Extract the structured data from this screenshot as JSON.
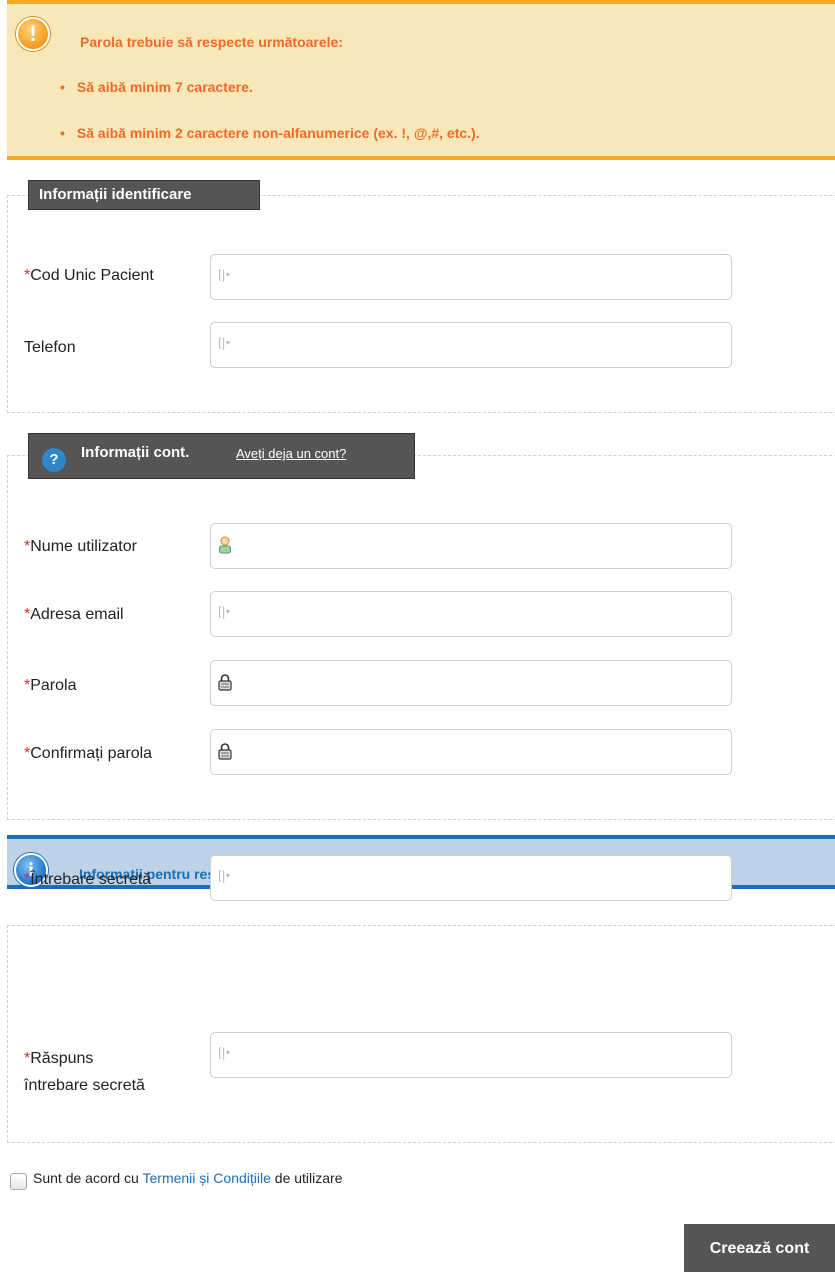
{
  "warning": {
    "title": "Parola trebuie să respecte următoarele:",
    "items": [
      "Să aibă minim 7 caractere.",
      "Să aibă minim 2 caractere non-alfanumerice (ex. !, @,#, etc.)."
    ],
    "icon": "warning-icon",
    "color": "#f26a2a"
  },
  "identification": {
    "legend": "Informații identificare",
    "fields": [
      {
        "label": "Cod Unic Pacient",
        "required": "*",
        "value": ""
      },
      {
        "label": "Telefon",
        "required": "",
        "value": ""
      }
    ]
  },
  "account": {
    "legend": "Informații cont.",
    "link": "Aveți deja un cont?",
    "fields": [
      {
        "label": "Nume utilizator",
        "required": "*",
        "value": "",
        "icon": "user-icon"
      },
      {
        "label": "Adresa email",
        "required": "*",
        "value": "",
        "icon": "text-cursor-icon"
      },
      {
        "label": "Parola",
        "required": "*",
        "value": "",
        "icon": "lock-icon"
      },
      {
        "label": "Confirmați parola",
        "required": "*",
        "value": "",
        "icon": "lock-icon"
      }
    ]
  },
  "reset": {
    "info": "Informatii pentru resetare parola.",
    "fields": [
      {
        "label": "Întrebare secretă",
        "required": "*",
        "value": ""
      },
      {
        "label_line1": "Răspuns",
        "label_line2": "întrebare secretă",
        "required": "*",
        "value": ""
      }
    ]
  },
  "terms": {
    "prefix": "Sunt de acord cu",
    "link": "Termenii și Condițiile",
    "suffix": "de utilizare"
  },
  "submit": {
    "label": "Creează cont"
  },
  "colors": {
    "required": "#d0342c",
    "link": "#1b6fb6",
    "warning_border": "#f5a623",
    "info_border": "#1b6fb6"
  }
}
